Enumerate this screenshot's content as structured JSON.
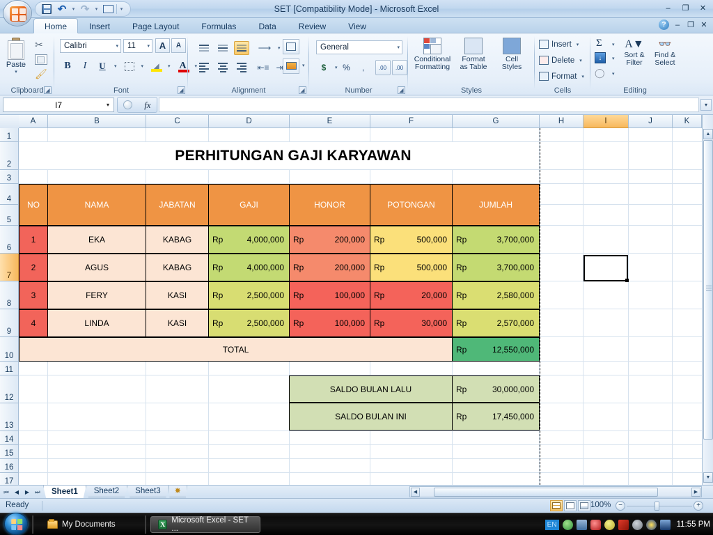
{
  "window": {
    "title": "SET  [Compatibility Mode] - Microsoft Excel",
    "minimize": "–",
    "restore": "❐",
    "close": "✕"
  },
  "quick_access": {
    "save_icon": "save-icon",
    "undo_icon": "undo-icon",
    "redo_icon": "redo-icon",
    "more_icon": "customize-qat-icon",
    "caret": "▾"
  },
  "ribbon": {
    "tabs": [
      {
        "label": "Home",
        "active": true
      },
      {
        "label": "Insert",
        "active": false
      },
      {
        "label": "Page Layout",
        "active": false
      },
      {
        "label": "Formulas",
        "active": false
      },
      {
        "label": "Data",
        "active": false
      },
      {
        "label": "Review",
        "active": false
      },
      {
        "label": "View",
        "active": false
      }
    ],
    "help_icon": "help-icon",
    "window_minimize": "–",
    "window_restore": "❐",
    "window_close": "✕",
    "groups": {
      "clipboard": {
        "label": "Clipboard",
        "paste_label": "Paste",
        "paste_caret": "▾",
        "cut_icon": "scissors-icon",
        "copy_icon": "copy-icon",
        "format_painter_icon": "format-painter-icon"
      },
      "font": {
        "label": "Font",
        "font_name": "Calibri",
        "font_size": "11",
        "grow_font": "A",
        "shrink_font": "A",
        "bold": "B",
        "italic": "I",
        "underline": "U",
        "borders_icon": "borders-icon",
        "fill_color_icon": "fill-color-icon",
        "font_color_icon": "font-color-icon",
        "caret": "▾"
      },
      "alignment": {
        "label": "Alignment",
        "top_align_icon": "align-top-icon",
        "middle_align_icon": "align-middle-icon",
        "bottom_align_icon": "align-bottom-icon",
        "orientation_icon": "orientation-icon",
        "align_left_icon": "align-left-icon",
        "align_center_icon": "align-center-icon",
        "align_right_icon": "align-right-icon",
        "decrease_indent_icon": "decrease-indent-icon",
        "increase_indent_icon": "increase-indent-icon",
        "wrap_text_icon": "wrap-text-icon",
        "merge_center_icon": "merge-and-center-icon"
      },
      "number": {
        "label": "Number",
        "format": "General",
        "accounting": "$",
        "percent": "%",
        "comma": ",",
        "increase_decimal": ".00",
        "decrease_decimal": ".00",
        "caret": "▾"
      },
      "styles": {
        "label": "Styles",
        "conditional_formatting": "Conditional\nFormatting",
        "conditional_formatting_l1": "Conditional",
        "conditional_formatting_l2": "Formatting",
        "format_as_table_l1": "Format",
        "format_as_table_l2": "as Table",
        "cell_styles_l1": "Cell",
        "cell_styles_l2": "Styles",
        "caret": "▾"
      },
      "cells": {
        "label": "Cells",
        "insert": "Insert",
        "delete": "Delete",
        "format": "Format",
        "caret": "▾"
      },
      "editing": {
        "label": "Editing",
        "autosum_icon": "sigma-icon",
        "fill_icon": "fill-down-icon",
        "clear_icon": "eraser-icon",
        "sort_filter_l1": "Sort &",
        "sort_filter_l2": "Filter",
        "find_select_l1": "Find &",
        "find_select_l2": "Select",
        "caret": "▾"
      }
    }
  },
  "formula_bar": {
    "name_box": "I7",
    "name_box_caret": "▾",
    "insert_function_icon": "fx",
    "formula_value": "",
    "expand_caret": "▾"
  },
  "grid": {
    "columns": [
      "A",
      "B",
      "C",
      "D",
      "E",
      "F",
      "G",
      "H",
      "I",
      "J",
      "K"
    ],
    "selected_column": "I",
    "rows": [
      "1",
      "2",
      "3",
      "4",
      "5",
      "6",
      "7",
      "8",
      "9",
      "10",
      "11",
      "12",
      "13",
      "14",
      "15",
      "16",
      "17"
    ],
    "selected_row": "7",
    "selected_cell": "I7"
  },
  "sheet": {
    "title": "PERHITUNGAN GAJI KARYAWAN",
    "headers": [
      "NO",
      "NAMA",
      "JABATAN",
      "GAJI",
      "HONOR",
      "POTONGAN",
      "JUMLAH"
    ],
    "currency_symbol": "Rp",
    "rows": [
      {
        "no": "1",
        "nama": "EKA",
        "jabatan": "KABAG",
        "gaji": "4,000,000",
        "honor": "200,000",
        "potongan": "500,000",
        "jumlah": "3,700,000"
      },
      {
        "no": "2",
        "nama": "AGUS",
        "jabatan": "KABAG",
        "gaji": "4,000,000",
        "honor": "200,000",
        "potongan": "500,000",
        "jumlah": "3,700,000"
      },
      {
        "no": "3",
        "nama": "FERY",
        "jabatan": "KASI",
        "gaji": "2,500,000",
        "honor": "100,000",
        "potongan": "20,000",
        "jumlah": "2,580,000"
      },
      {
        "no": "4",
        "nama": "LINDA",
        "jabatan": "KASI",
        "gaji": "2,500,000",
        "honor": "100,000",
        "potongan": "30,000",
        "jumlah": "2,570,000"
      }
    ],
    "total_label": "TOTAL",
    "total_value": "12,550,000",
    "saldo": [
      {
        "label": "SALDO BULAN LALU",
        "value": "30,000,000"
      },
      {
        "label": "SALDO BULAN INI",
        "value": "17,450,000"
      }
    ],
    "colors": {
      "header_orange": "#ef9444",
      "no_red": "#f2645a",
      "name_peach": "#fce5d4",
      "gaji_green_high": "#c3da73",
      "gaji_green_low": "#d8dd72",
      "honor_salmon": "#f58a6c",
      "honor_red": "#f4635a",
      "potongan_yellow": "#fbe07a",
      "potongan_red": "#f4635a",
      "jumlah_green_high": "#c4da72",
      "jumlah_green_low": "#dade72",
      "total_green": "#4fb878",
      "saldo_green": "#d2dfb4"
    }
  },
  "sheet_tabs": {
    "first_icon": "first-sheet-icon",
    "prev_icon": "previous-sheet-icon",
    "next_icon": "next-sheet-icon",
    "last_icon": "last-sheet-icon",
    "tabs": [
      {
        "label": "Sheet1",
        "active": true
      },
      {
        "label": "Sheet2",
        "active": false
      },
      {
        "label": "Sheet3",
        "active": false
      }
    ],
    "insert_sheet_icon": "insert-worksheet-icon"
  },
  "status_bar": {
    "status": "Ready",
    "view_normal_icon": "normal-view-icon",
    "view_layout_icon": "page-layout-view-icon",
    "view_break_icon": "page-break-preview-icon",
    "zoom": "100%",
    "zoom_out": "−",
    "zoom_in": "+"
  },
  "taskbar": {
    "start_icon": "windows-start-icon",
    "items": [
      {
        "label": "My Documents",
        "icon": "folder-icon",
        "active": false
      },
      {
        "label": "Microsoft Excel - SET  ...",
        "icon": "excel-icon",
        "active": true
      }
    ],
    "tray": {
      "language": "EN",
      "icons": [
        "network-icon",
        "display-icon",
        "security-icon",
        "update-icon",
        "antivirus-icon",
        "volume-icon",
        "wireless-icon",
        "monitor-icon"
      ],
      "clock": "11:55 PM"
    }
  }
}
